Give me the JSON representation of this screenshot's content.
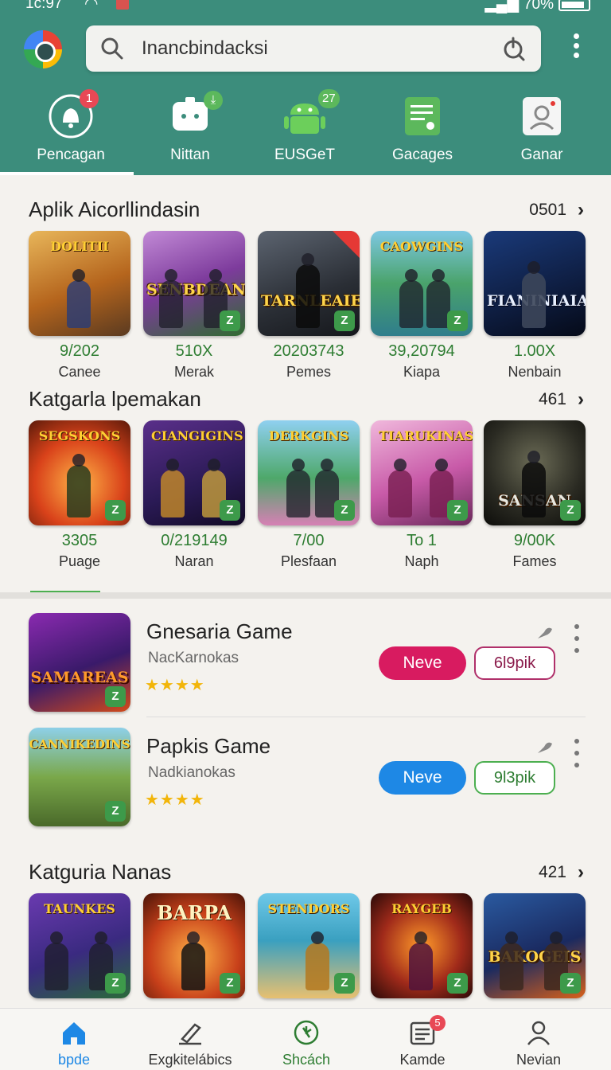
{
  "status": {
    "time": "1c:97",
    "battery": "70%",
    "signal": "4G"
  },
  "search": {
    "value": "Inancbindacksi"
  },
  "tabs": [
    {
      "label": "Pencagan",
      "badge": "1"
    },
    {
      "label": "Nittan",
      "badge": ""
    },
    {
      "label": "EUSGeT",
      "badge": "27"
    },
    {
      "label": "Gacages",
      "badge": ""
    },
    {
      "label": "Ganar",
      "badge": ""
    }
  ],
  "section1": {
    "title": "Aplik Aicorllindasin",
    "count": "0501",
    "items": [
      {
        "art": "DOLITII",
        "stat": "9/202",
        "name": "Canee"
      },
      {
        "art": "SENBDEAN",
        "stat": "510X",
        "name": "Merak"
      },
      {
        "art": "TARNLEAIE",
        "stat": "20203743",
        "name": "Pemes"
      },
      {
        "art": "CAOWGINS",
        "stat": "39,20794",
        "name": "Kiapa"
      },
      {
        "art": "FIANINIAIA",
        "stat": "1.00X",
        "name": "Nenbain"
      }
    ]
  },
  "section2": {
    "title": "Katgarla lpemakan",
    "count": "461",
    "items": [
      {
        "art": "SEGSKONS",
        "stat": "3305",
        "name": "Puage"
      },
      {
        "art": "CIANGIGINS",
        "stat": "0/219149",
        "name": "Naran"
      },
      {
        "art": "DERKGINS",
        "stat": "7/00",
        "name": "Plesfaan"
      },
      {
        "art": "TIARUKINAS",
        "stat": "To 1",
        "name": "Naph"
      },
      {
        "art": "SANSAN",
        "stat": "9/00K",
        "name": "Fames"
      }
    ]
  },
  "list": [
    {
      "art": "SAMAREAS",
      "title": "Gnesaria Game",
      "dev": "NacKarnokas",
      "stars": "★★★★",
      "primary": "Neve",
      "secondary": "6l9pik"
    },
    {
      "art": "CANNIKEDINS",
      "title": "Papkis Game",
      "dev": "Nadkianokas",
      "stars": "★★★★",
      "primary": "Neve",
      "secondary": "9l3pik"
    }
  ],
  "section3": {
    "title": "Katguria Nanas",
    "count": "421",
    "items": [
      {
        "art": "TAUNKES"
      },
      {
        "art": "BARPA"
      },
      {
        "art": "STENDORS"
      },
      {
        "art": "RAYGEB"
      },
      {
        "art": "BAKOGEIS"
      }
    ]
  },
  "bottom_nav": [
    {
      "label": "bpde"
    },
    {
      "label": "Exgkitelábics"
    },
    {
      "label": "Shcách"
    },
    {
      "label": "Kamde",
      "badge": "5"
    },
    {
      "label": "Nevian"
    }
  ],
  "colors": {
    "header": "#3c8d7c",
    "primary_magenta": "#d81b60",
    "primary_blue": "#1e88e5",
    "stat_green": "#2e7d32",
    "star": "#f2b50a"
  }
}
